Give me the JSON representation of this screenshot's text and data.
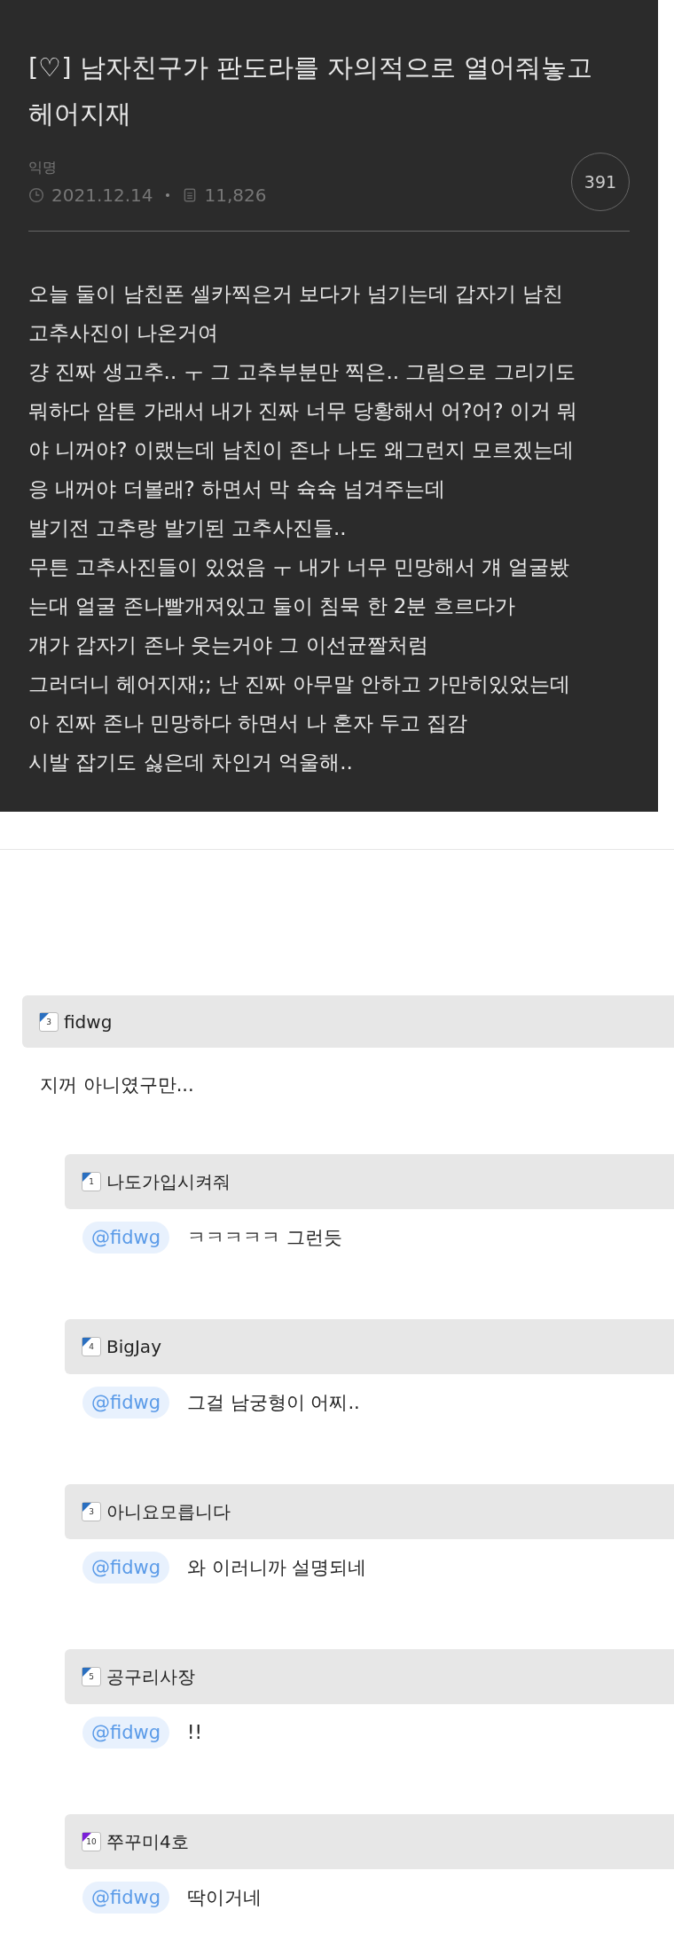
{
  "post": {
    "title": "[♡] 남자친구가 판도라를 자의적으로 열어줘놓고 헤어지재",
    "author": "익명",
    "date": "2021.12.14",
    "views": "11,826",
    "comment_count": "391",
    "body": [
      "오늘 둘이 남친폰 셀카찍은거 보다가 넘기는데 갑자기 남친",
      "고추사진이 나온거여",
      "걍 진짜 생고추.. ㅜ 그 고추부분만 찍은.. 그림으로 그리기도",
      "뭐하다 암튼 가래서 내가 진짜 너무 당황해서 어?어? 이거 뭐",
      "야 니꺼야? 이랬는데 남친이 존나 나도 왜그런지 모르겠는데",
      "응 내꺼야 더볼래? 하면서 막 슉슉 넘겨주는데",
      "발기전 고추랑 발기된 고추사진들..",
      "무튼 고추사진들이 있었음 ㅜ 내가 너무 민망해서 걔 얼굴봤",
      "는대 얼굴 존나빨개져있고 둘이 침묵 한 2분 흐르다가",
      "걔가 갑자기 존나 웃는거야 그 이선균짤처럼",
      "그러더니 헤어지재;; 난 진짜 아무말 안하고 가만히있었는데",
      "아 진짜 존나 민망하다 하면서 나 혼자 두고 집감",
      "시발 잡기도 싫은데 차인거 억울해.."
    ]
  },
  "comment": {
    "level": "3",
    "color": "#2a6fc0",
    "author": "fidwg",
    "text": "지꺼 아니였구만...",
    "replies": [
      {
        "level": "1",
        "color": "#2a6fc0",
        "author": "나도가입시켜줘",
        "mention": "@fidwg",
        "text": "ㅋㅋㅋㅋㅋ 그런듯"
      },
      {
        "level": "4",
        "color": "#2a6fc0",
        "author": "BigJay",
        "mention": "@fidwg",
        "text": "그걸 남궁형이 어찌.."
      },
      {
        "level": "3",
        "color": "#2a6fc0",
        "author": "아니요모릅니다",
        "mention": "@fidwg",
        "text": "와 이러니까 설명되네"
      },
      {
        "level": "5",
        "color": "#2a6fc0",
        "author": "공구리사장",
        "mention": "@fidwg",
        "text": "!!"
      },
      {
        "level": "10",
        "color": "#7a1fd8",
        "author": "쭈꾸미4호",
        "mention": "@fidwg",
        "text": "딱이거네"
      }
    ]
  }
}
